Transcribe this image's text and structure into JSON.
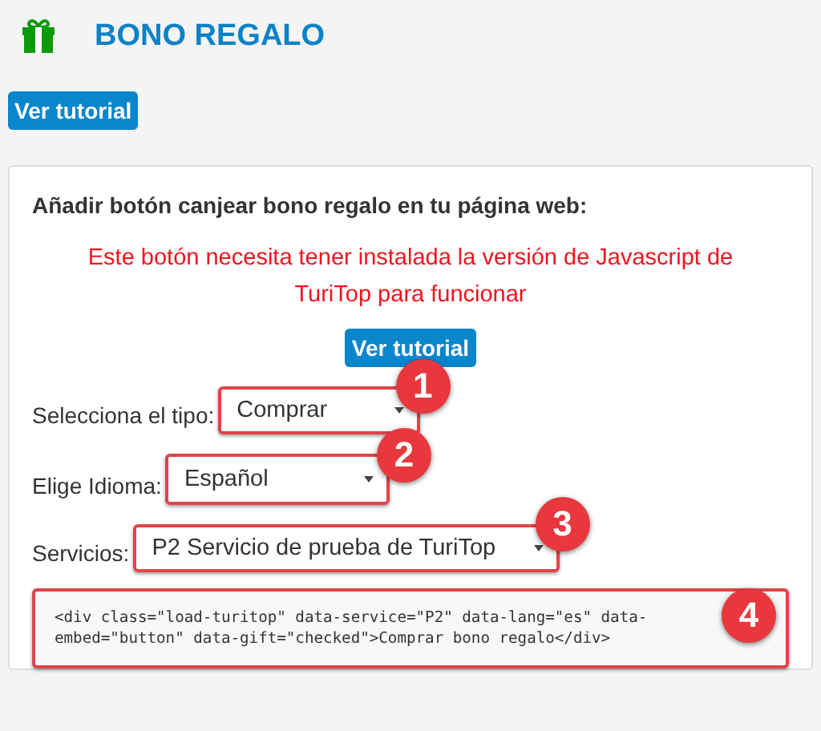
{
  "header": {
    "title": "BONO REGALO",
    "button": "Ver tutorial"
  },
  "card": {
    "heading": "Añadir botón canjear bono regalo en tu página web:",
    "warning": "Este botón necesita tener instalada la versión de Javascript de TuriTop para funcionar",
    "button": "Ver tutorial",
    "fields": [
      {
        "label": "Selecciona el tipo:",
        "value": "Comprar",
        "badge": "1"
      },
      {
        "label": "Elige Idioma:",
        "value": "Español",
        "badge": "2"
      },
      {
        "label": "Servicios:",
        "value": "P2 Servicio de prueba de TuriTop",
        "badge": "3"
      }
    ],
    "code": {
      "text": "<div class=\"load-turitop\" data-service=\"P2\" data-lang=\"es\" data-embed=\"button\" data-gift=\"checked\">Comprar bono regalo</div>",
      "badge": "4"
    }
  }
}
